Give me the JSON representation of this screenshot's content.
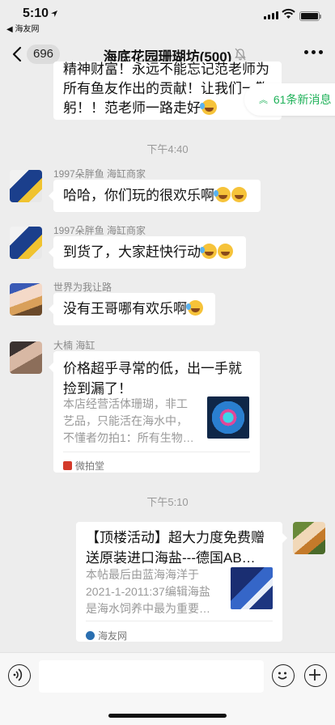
{
  "status_bar": {
    "time": "5:10",
    "back_app": "◀ 海友网"
  },
  "nav": {
    "back_count": "696",
    "title": "海底花园珊瑚坊(500)"
  },
  "new_messages": "61条新消息",
  "messages": [
    {
      "type": "text",
      "text_lines": [
        "精神财富！永远不能忘记范老师为",
        "所有鱼友作出的贡献！让我们一鞠",
        "躬！！范老师一路走好"
      ]
    },
    {
      "type": "time",
      "text": "下午4:40"
    },
    {
      "type": "text",
      "sender": "1997朵胖鱼 海缸商家",
      "text": "哈哈，你们玩的很欢乐啊"
    },
    {
      "type": "text",
      "sender": "1997朵胖鱼 海缸商家",
      "text": "到货了，大家赶快行动"
    },
    {
      "type": "text",
      "sender": "世界为我让路",
      "text": "没有王哥哪有欢乐啊"
    },
    {
      "type": "card",
      "sender": "大楠 海缸",
      "title_lines": [
        "价格超乎寻常的低，出一手就",
        "捡到漏了！"
      ],
      "desc_lines": [
        "本店经营活体珊瑚，非工",
        "艺品，只能活在海水中，",
        "不懂者勿拍1：所有生物…"
      ],
      "source": "微拍堂"
    },
    {
      "type": "time",
      "text": "下午5:10"
    },
    {
      "type": "card",
      "side": "right",
      "title_lines": [
        "【顶楼活动】超大力度免费赠",
        "送原装进口海盐---德国AB…"
      ],
      "desc_lines": [
        "本帖最后由蓝海海洋于",
        "2021-1-2011:37编辑海盐",
        "是海水饲养中最为重要…"
      ],
      "source": "海友网"
    }
  ],
  "colors": {
    "background": "#ededed",
    "accent": "#20b25a",
    "bubble": "#ffffff"
  }
}
